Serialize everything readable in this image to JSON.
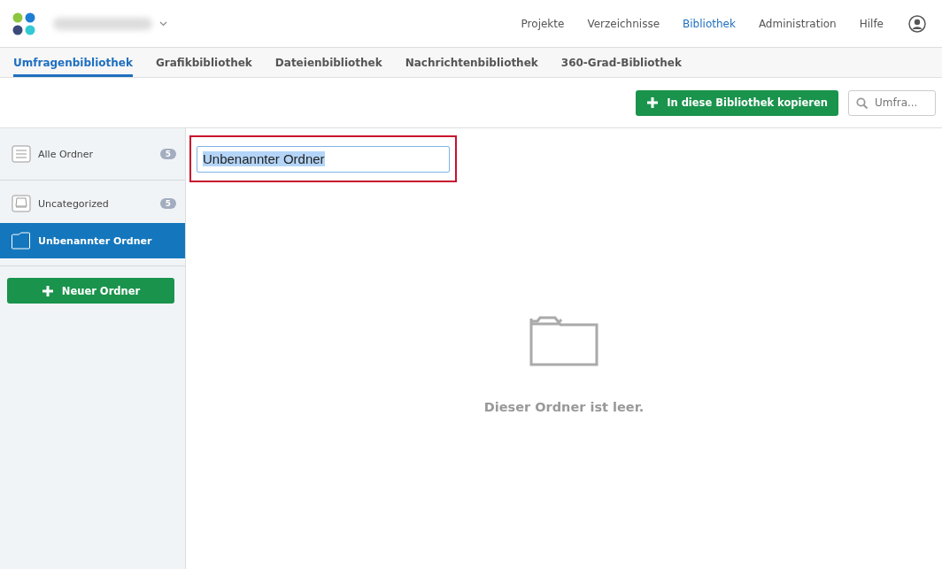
{
  "header": {
    "nav": [
      {
        "label": "Projekte",
        "selected": false
      },
      {
        "label": "Verzeichnisse",
        "selected": false
      },
      {
        "label": "Bibliothek",
        "selected": true
      },
      {
        "label": "Administration",
        "selected": false
      },
      {
        "label": "Hilfe",
        "selected": false
      }
    ]
  },
  "tabs": [
    {
      "label": "Umfragenbibliothek",
      "selected": true
    },
    {
      "label": "Grafikbibliothek",
      "selected": false
    },
    {
      "label": "Dateienbibliothek",
      "selected": false
    },
    {
      "label": "Nachrichtenbibliothek",
      "selected": false
    },
    {
      "label": "360-Grad-Bibliothek",
      "selected": false
    }
  ],
  "toolbar": {
    "copy_button": "In diese Bibliothek kopieren",
    "search": {
      "placeholder": "Umfra..."
    }
  },
  "sidebar": {
    "items": [
      {
        "kind": "all",
        "label": "Alle Ordner",
        "count": "5",
        "selected": false
      },
      {
        "kind": "tray",
        "label": "Uncategorized",
        "count": "5",
        "selected": false
      },
      {
        "kind": "folder",
        "label": "Unbenannter Ordner",
        "selected": true
      }
    ],
    "new_button": "Neuer Ordner"
  },
  "main": {
    "folder_name": {
      "value": "Unbenannter Ordner",
      "text_selected": true,
      "highlighted": true
    },
    "empty_message": "Dieser Ordner ist leer."
  }
}
